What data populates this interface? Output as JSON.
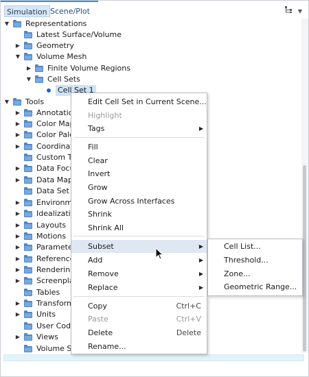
{
  "tabs": [
    {
      "label": "Simulation",
      "active": true
    },
    {
      "label": "Scene/Plot",
      "active": false
    }
  ],
  "toolbar": {
    "tree_icon": "hierarchy-icon",
    "dropdown_icon": "chevron-down-icon"
  },
  "tree": {
    "representations": "Representations",
    "latest_surface_volume": "Latest Surface/Volume",
    "geometry": "Geometry",
    "volume_mesh": "Volume Mesh",
    "finite_volume_regions": "Finite Volume Regions",
    "cell_sets": "Cell Sets",
    "cell_set_1": "Cell Set 1",
    "tools": "Tools",
    "tools_items": [
      "Annotatio",
      "Color Map",
      "Color Pale",
      "Coordinat",
      "Custom Tu",
      "Data Focu",
      "Data Map",
      "Data Set F",
      "Environm",
      "Idealizatio",
      "Layouts",
      "Motions",
      "Paramete",
      "Reference",
      "Rendering",
      "Screenpla",
      "Tables",
      "Transform",
      "Units",
      "User Code",
      "Views",
      "Volume Sh"
    ]
  },
  "context_menu": {
    "edit": "Edit Cell Set in Current Scene...",
    "highlight": "Highlight",
    "tags": "Tags",
    "fill": "Fill",
    "clear": "Clear",
    "invert": "Invert",
    "grow": "Grow",
    "grow_across": "Grow Across Interfaces",
    "shrink": "Shrink",
    "shrink_all": "Shrink All",
    "subset": "Subset",
    "add": "Add",
    "remove": "Remove",
    "replace": "Replace",
    "copy": "Copy",
    "copy_shortcut": "Ctrl+C",
    "paste": "Paste",
    "paste_shortcut": "Ctrl+V",
    "delete": "Delete",
    "delete_shortcut": "Delete",
    "rename": "Rename..."
  },
  "submenu": {
    "cell_list": "Cell List...",
    "threshold": "Threshold...",
    "zone": "Zone...",
    "geometric_range": "Geometric Range..."
  }
}
